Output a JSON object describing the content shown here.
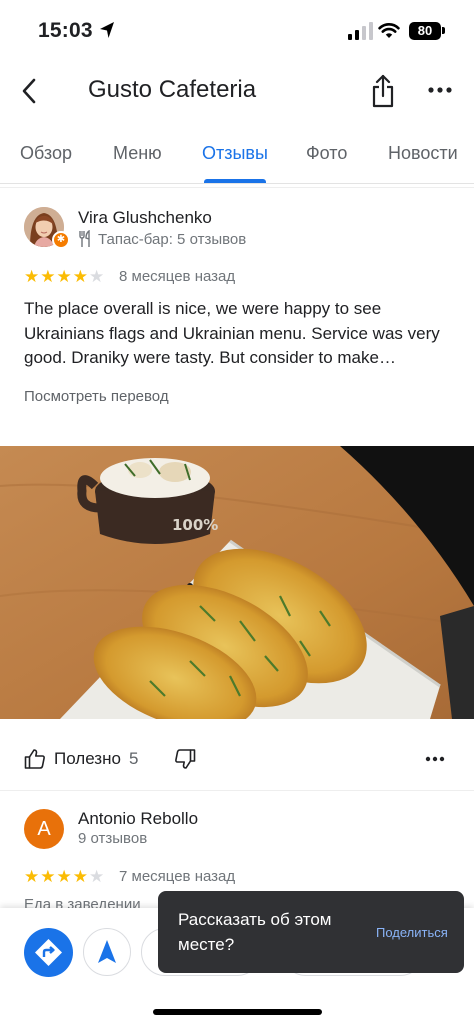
{
  "status_bar": {
    "time": "15:03",
    "battery": "80"
  },
  "header": {
    "title": "Gusto Cafeteria",
    "icons": [
      "back-arrow-icon",
      "share-icon",
      "more-horizontal-icon"
    ]
  },
  "tabs": [
    {
      "label": "Обзор",
      "active": false
    },
    {
      "label": "Меню",
      "active": false
    },
    {
      "label": "Отзывы",
      "active": true
    },
    {
      "label": "Фото",
      "active": false
    },
    {
      "label": "Новости",
      "active": false
    }
  ],
  "reviews": [
    {
      "name": "Vira Glushchenko",
      "meta": "Тапас-бар: 5 отзывов",
      "rating": 4,
      "date": "8 месяцев назад",
      "text": "The place overall is nice, we were happy to see Ukrainians flags and Ukrainian menu. Service was very good. Draniky were tasty. But consider to make…",
      "translate": "Посмотреть перевод",
      "photo_text": "100%",
      "helpful_label": "Полезно",
      "helpful_count": "5"
    },
    {
      "name": "Antonio Rebollo",
      "initial": "A",
      "meta": "9 отзывов",
      "rating": 4,
      "date": "7 месяцев назад",
      "dine_in": "Еда в заведении"
    }
  ],
  "toast": {
    "text": "Рассказать об этом месте?",
    "action": "Поделиться"
  },
  "colors": {
    "accent": "#1a73e8",
    "star": "#fbbc04",
    "avatar_orange": "#e8710a",
    "toast_bg": "#303134",
    "toast_action": "#8ab4f8"
  }
}
